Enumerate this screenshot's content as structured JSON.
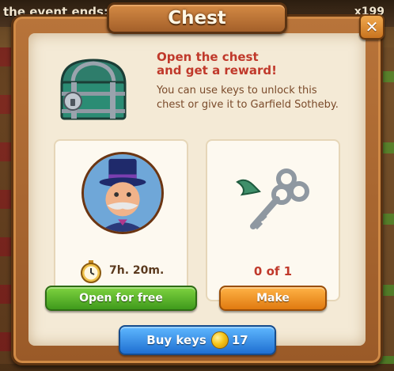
{
  "background": {
    "event_text": "the event ends:",
    "count_text": "x199"
  },
  "dialog": {
    "title": "Chest",
    "close_icon": "close-icon",
    "heading_line1": "Open the chest",
    "heading_line2": "and get a reward!",
    "description": "You can use keys to unlock this chest or give it to Garfield Sotheby."
  },
  "left_card": {
    "portrait": "character-portrait",
    "timer_icon": "stopwatch-icon",
    "timer_text": "7h. 20m.",
    "button_label": "Open for free"
  },
  "right_card": {
    "item_icon": "key-icon",
    "progress_text": "0 of 1",
    "button_label": "Make"
  },
  "buy": {
    "label": "Buy keys",
    "coin_icon": "coin-icon",
    "price": "17"
  },
  "colors": {
    "heading": "#c0392b",
    "green_button": "#4caf1f",
    "orange_button": "#f0901e",
    "blue_button": "#2f86e0"
  }
}
